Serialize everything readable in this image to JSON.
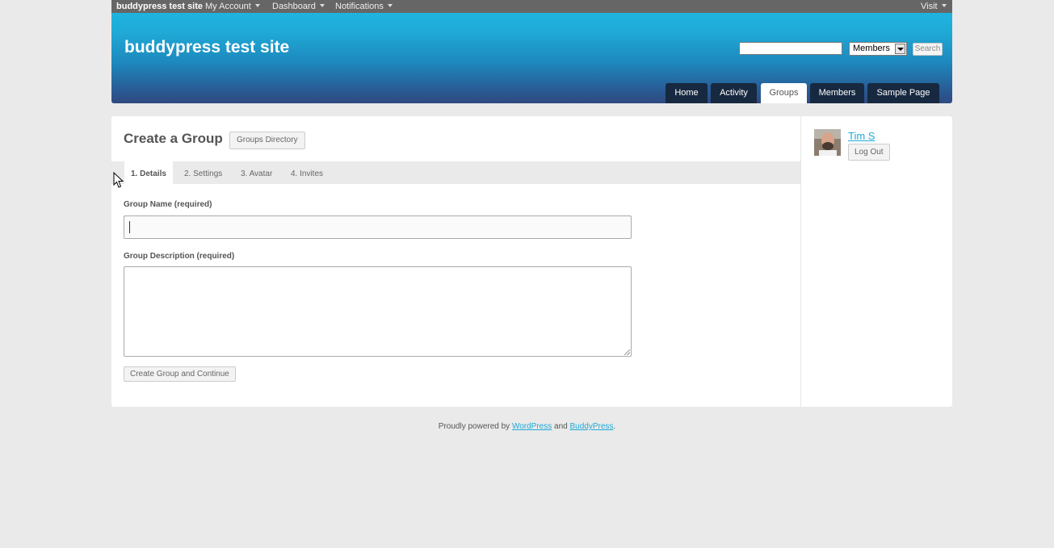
{
  "admin_bar": {
    "site_name": "buddypress test site",
    "menus": [
      "My Account",
      "Dashboard",
      "Notifications"
    ],
    "visit_label": "Visit"
  },
  "header": {
    "site_title": "buddypress test site",
    "search": {
      "input_value": "",
      "select_value": "Members",
      "button_label": "Search"
    },
    "nav_tabs": [
      {
        "label": "Home",
        "active": false
      },
      {
        "label": "Activity",
        "active": false
      },
      {
        "label": "Groups",
        "active": true
      },
      {
        "label": "Members",
        "active": false
      },
      {
        "label": "Sample Page",
        "active": false
      }
    ]
  },
  "main": {
    "page_title": "Create a Group",
    "directory_button": "Groups Directory",
    "steps": [
      {
        "label": "1. Details",
        "current": true
      },
      {
        "label": "2. Settings",
        "current": false
      },
      {
        "label": "3. Avatar",
        "current": false
      },
      {
        "label": "4. Invites",
        "current": false
      }
    ],
    "group_name_label": "Group Name (required)",
    "group_name_value": "",
    "group_description_label": "Group Description (required)",
    "group_description_value": "",
    "submit_label": "Create Group and Continue"
  },
  "sidebar": {
    "user_name": "Tim S",
    "logout_label": "Log Out"
  },
  "footer": {
    "prefix": "Proudly powered by ",
    "link1": "WordPress",
    "middle": " and ",
    "link2": "BuddyPress",
    "suffix": "."
  },
  "colors": {
    "accent": "#1fa9d6",
    "nav_tab": "#172940",
    "admin_bar": "#666666",
    "page_bg": "#eaeaea"
  }
}
